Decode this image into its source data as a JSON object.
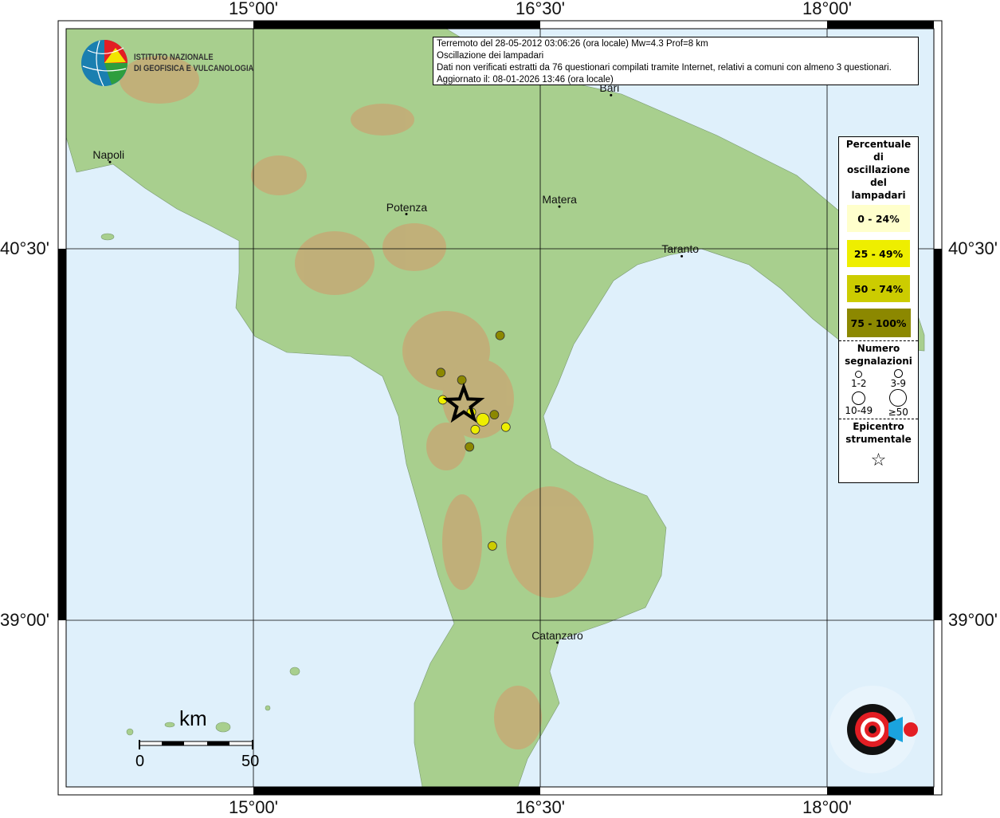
{
  "map": {
    "lon_ticks": [
      "15°00'",
      "16°30'",
      "18°00'"
    ],
    "lat_ticks": [
      "40°30'",
      "39°00'"
    ],
    "colors": {
      "sea": "#dff0fb",
      "land": "#9fc98a",
      "relief": "#c9a572"
    }
  },
  "info_box": {
    "line1": "Terremoto del 28-05-2012 03:06:26 (ora locale) Mw=4.3 Prof=8 km",
    "line2": "Oscillazione dei lampadari",
    "line3": "Dati non verificati estratti da 76 questionari compilati tramite Internet, relativi a comuni con almeno 3 questionari.",
    "line4": "Aggiornato il: 08-01-2026 13:46 (ora locale)"
  },
  "cities": [
    {
      "name": "Napoli",
      "lon": 14.25,
      "lat": 40.85
    },
    {
      "name": "Potenza",
      "lon": 15.8,
      "lat": 40.64
    },
    {
      "name": "Matera",
      "lon": 16.6,
      "lat": 40.67
    },
    {
      "name": "Bari",
      "lon": 16.87,
      "lat": 41.12
    },
    {
      "name": "Taranto",
      "lon": 17.24,
      "lat": 40.47
    },
    {
      "name": "Catanzaro",
      "lon": 16.59,
      "lat": 38.91
    }
  ],
  "legend": {
    "title": [
      "Percentuale",
      "di",
      "oscillazione",
      "del",
      "lampadari"
    ],
    "classes": [
      {
        "label": "0 - 24%",
        "color": "#ffffcc"
      },
      {
        "label": "25 - 49%",
        "color": "#eeee00"
      },
      {
        "label": "50 - 74%",
        "color": "#cccc00"
      },
      {
        "label": "75 - 100%",
        "color": "#8c8800"
      }
    ],
    "count_title": [
      "Numero",
      "segnalazioni"
    ],
    "counts": [
      "1-2",
      "3-9",
      "10-49",
      "≥50"
    ],
    "epicenter_title": [
      "Epicentro",
      "strumentale"
    ]
  },
  "epicenter": {
    "lon": 16.1,
    "lat": 39.87,
    "icon": "star-icon"
  },
  "observations": [
    {
      "lon": 16.29,
      "lat": 40.15,
      "class": 3,
      "count": "3-9"
    },
    {
      "lon": 15.98,
      "lat": 40.0,
      "class": 3,
      "count": "3-9"
    },
    {
      "lon": 16.09,
      "lat": 39.97,
      "class": 3,
      "count": "3-9"
    },
    {
      "lon": 15.99,
      "lat": 39.89,
      "class": 1,
      "count": "3-9"
    },
    {
      "lon": 16.14,
      "lat": 39.84,
      "class": 1,
      "count": "3-9"
    },
    {
      "lon": 16.2,
      "lat": 39.81,
      "class": 1,
      "count": "10-49"
    },
    {
      "lon": 16.26,
      "lat": 39.83,
      "class": 3,
      "count": "3-9"
    },
    {
      "lon": 16.16,
      "lat": 39.77,
      "class": 1,
      "count": "3-9"
    },
    {
      "lon": 16.32,
      "lat": 39.78,
      "class": 1,
      "count": "3-9"
    },
    {
      "lon": 16.13,
      "lat": 39.7,
      "class": 3,
      "count": "3-9"
    },
    {
      "lon": 16.25,
      "lat": 39.3,
      "class": 2,
      "count": "3-9"
    }
  ],
  "scale_bar": {
    "unit": "km",
    "start": "0",
    "end": "50"
  },
  "logos": {
    "ingv": [
      "ISTITUTO NAZIONALE",
      "DI GEOFISICA E VULCANOLOGIA"
    ],
    "hsit": "haisentitoilterremoto.it www"
  }
}
